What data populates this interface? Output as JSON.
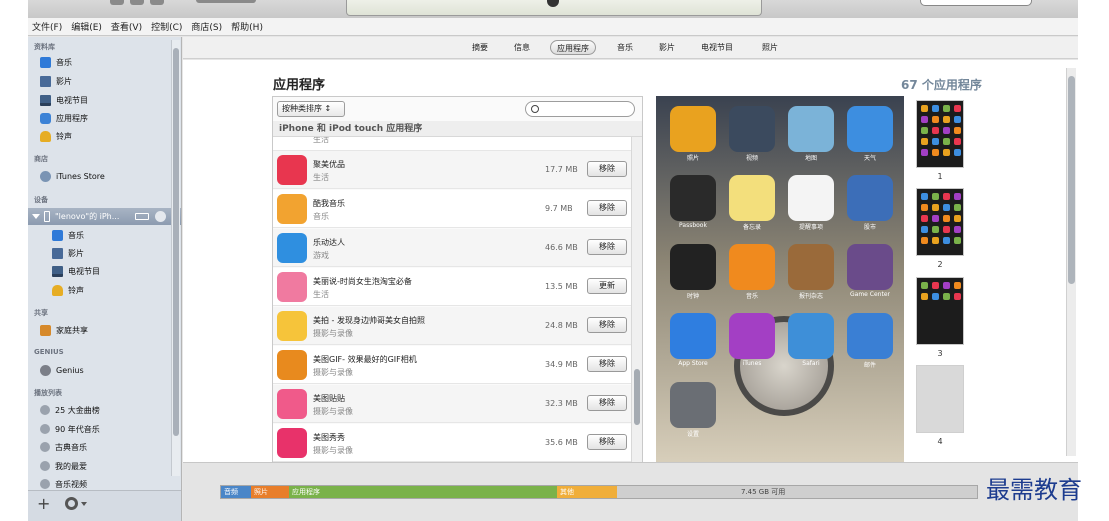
{
  "menu": [
    "文件(F)",
    "编辑(E)",
    "查看(V)",
    "控制(C)",
    "商店(S)",
    "帮助(H)"
  ],
  "sidebar": {
    "library_header": "资料库",
    "library": [
      {
        "label": "音乐",
        "icon": "music-icon"
      },
      {
        "label": "影片",
        "icon": "film-icon"
      },
      {
        "label": "电视节目",
        "icon": "tv-icon"
      },
      {
        "label": "应用程序",
        "icon": "app-icon"
      },
      {
        "label": "铃声",
        "icon": "bell-icon"
      }
    ],
    "store_header": "商店",
    "store": [
      {
        "label": "iTunes Store",
        "icon": "store-icon"
      }
    ],
    "devices_header": "设备",
    "device_name": "\"lenovo\"的 iPh...",
    "device_items": [
      {
        "label": "音乐",
        "icon": "music-icon"
      },
      {
        "label": "影片",
        "icon": "film-icon"
      },
      {
        "label": "电视节目",
        "icon": "tv-icon"
      },
      {
        "label": "铃声",
        "icon": "bell-icon"
      }
    ],
    "shared_header": "共享",
    "shared": [
      {
        "label": "家庭共享",
        "icon": "home-share-icon"
      }
    ],
    "genius_header": "GENIUS",
    "genius": [
      {
        "label": "Genius",
        "icon": "genius-icon"
      }
    ],
    "playlists_header": "播放列表",
    "playlists": [
      {
        "label": "25 大金曲榜",
        "icon": "gear-icon"
      },
      {
        "label": "90 年代音乐",
        "icon": "gear-icon"
      },
      {
        "label": "古典音乐",
        "icon": "gear-icon"
      },
      {
        "label": "我的最爱",
        "icon": "gear-icon"
      },
      {
        "label": "音乐视频",
        "icon": "gear-icon"
      }
    ],
    "add_label": "+"
  },
  "tabs": [
    "摘要",
    "信息",
    "应用程序",
    "音乐",
    "影片",
    "电视节目",
    "照片"
  ],
  "active_tab": "应用程序",
  "apps": {
    "title": "应用程序",
    "count": "67 个应用程序",
    "sort_label": "按种类排序 ↕",
    "section": "iPhone 和 iPod touch 应用程序",
    "partial_category": "生活",
    "list": [
      {
        "name": "聚美优品",
        "category": "生活",
        "size": "17.7 MB",
        "action": "移除",
        "color": "#e8364f"
      },
      {
        "name": "酷我音乐",
        "category": "音乐",
        "size": "9.7 MB",
        "action": "移除",
        "color": "#f2a330"
      },
      {
        "name": "乐动达人",
        "category": "游戏",
        "size": "46.6 MB",
        "action": "移除",
        "color": "#2f8fe0"
      },
      {
        "name": "美丽说-时尚女生泡淘宝必备",
        "category": "生活",
        "size": "13.5 MB",
        "action": "更新",
        "color": "#f07aa0"
      },
      {
        "name": "美拍 - 发现身边帅哥美女自拍照",
        "category": "摄影与录像",
        "size": "24.8 MB",
        "action": "移除",
        "color": "#f6c43a"
      },
      {
        "name": "美图GIF- 效果最好的GIF相机",
        "category": "摄影与录像",
        "size": "34.9 MB",
        "action": "移除",
        "color": "#e88a1e"
      },
      {
        "name": "美图贴贴",
        "category": "摄影与录像",
        "size": "32.3 MB",
        "action": "移除",
        "color": "#f05a8a"
      },
      {
        "name": "美图秀秀",
        "category": "摄影与录像",
        "size": "35.6 MB",
        "action": "移除",
        "color": "#e8326a"
      }
    ]
  },
  "home_screen": [
    {
      "label": "照片",
      "color": "#e9a21f",
      "icon": "photos-icon"
    },
    {
      "label": "视频",
      "color": "#3b4a5e",
      "icon": "videos-icon"
    },
    {
      "label": "地图",
      "color": "#7bb3d8",
      "icon": "maps-icon"
    },
    {
      "label": "天气",
      "color": "#3d8ee0",
      "icon": "weather-icon"
    },
    {
      "label": "Passbook",
      "color": "#2a2a2a",
      "icon": "passbook-icon"
    },
    {
      "label": "备忘录",
      "color": "#f3df7c",
      "icon": "notes-icon"
    },
    {
      "label": "提醒事项",
      "color": "#f4f4f4",
      "icon": "reminders-icon"
    },
    {
      "label": "股市",
      "color": "#3c6eb8",
      "icon": "stocks-icon"
    },
    {
      "label": "时钟",
      "color": "#222222",
      "icon": "clock-icon"
    },
    {
      "label": "音乐",
      "color": "#f08a1e",
      "icon": "itunes-music-icon"
    },
    {
      "label": "报刊杂志",
      "color": "#9a6a3a",
      "icon": "newsstand-icon"
    },
    {
      "label": "Game Center",
      "color": "#6a4b8a",
      "icon": "game-center-icon"
    },
    {
      "label": "App Store",
      "color": "#2f7ee0",
      "icon": "app-store-icon"
    },
    {
      "label": "iTunes",
      "color": "#a33fc4",
      "icon": "itunes-icon"
    },
    {
      "label": "Safari",
      "color": "#3e8fd8",
      "icon": "safari-icon"
    },
    {
      "label": "邮件",
      "color": "#3a7fd4",
      "icon": "mail-icon"
    },
    {
      "label": "设置",
      "color": "#6a6e74",
      "icon": "settings-icon"
    }
  ],
  "pages": [
    "1",
    "2",
    "3",
    "4"
  ],
  "capacity": {
    "segments": [
      {
        "label": "音频",
        "color": "#4a86c8",
        "fraction": 0.04
      },
      {
        "label": "照片",
        "color": "#e87e2a",
        "fraction": 0.05
      },
      {
        "label": "应用程序",
        "color": "#7ab24a",
        "fraction": 0.355
      },
      {
        "label": "其他",
        "color": "#f0ae3a",
        "fraction": 0.08
      }
    ],
    "free": "7.45 GB 可用"
  },
  "watermark": "最需教育"
}
